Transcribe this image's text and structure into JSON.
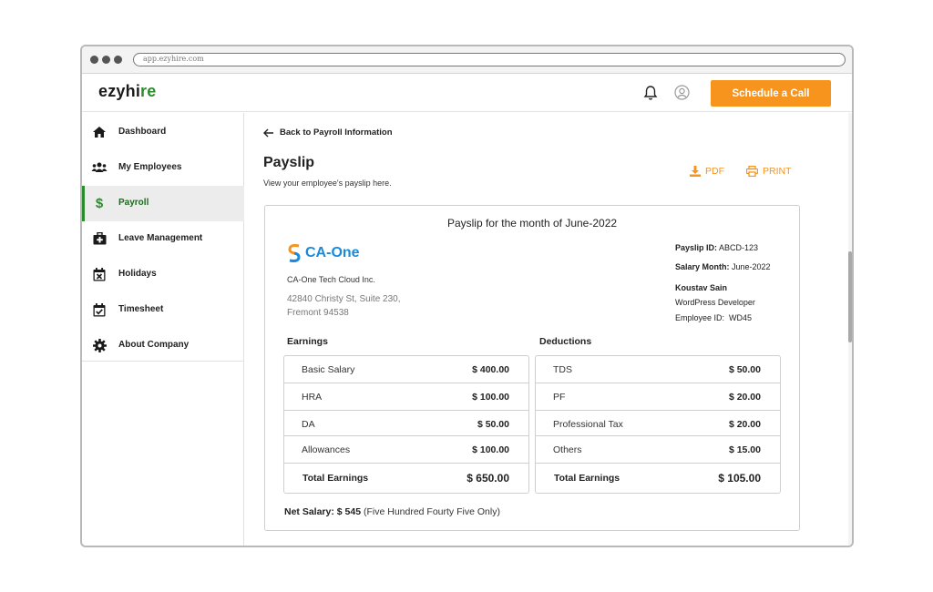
{
  "browser": {
    "url": "app.ezyhire.com"
  },
  "app": {
    "logo_main": "ezyhi",
    "logo_accent": "re",
    "schedule_label": "Schedule a Call"
  },
  "sidebar": {
    "items": [
      {
        "label": "Dashboard",
        "icon": "home-icon"
      },
      {
        "label": "My Employees",
        "icon": "users-icon"
      },
      {
        "label": "Payroll",
        "icon": "dollar-icon",
        "active": true
      },
      {
        "label": "Leave Management",
        "icon": "medical-kit-icon"
      },
      {
        "label": "Holidays",
        "icon": "calendar-x-icon"
      },
      {
        "label": "Timesheet",
        "icon": "calendar-check-icon"
      },
      {
        "label": "About Company",
        "icon": "gear-icon"
      }
    ]
  },
  "main": {
    "back_label": "Back to Payroll Information",
    "title": "Payslip",
    "subtitle": "View your employee's payslip here.",
    "pdf_label": "PDF",
    "print_label": "PRINT"
  },
  "payslip": {
    "heading": "Payslip for the month of June-2022",
    "company_logo_text": "CA-One",
    "company_name": "CA-One Tech Cloud Inc.",
    "address_line1": "42840 Christy St, Suite 230,",
    "address_line2": "Fremont 94538",
    "payslip_id_label": "Payslip ID:",
    "payslip_id": "ABCD-123",
    "salary_month_label": "Salary Month:",
    "salary_month": "June-2022",
    "employee_name": "Koustav Sain",
    "employee_role": "WordPress Developer",
    "employee_id_label": "Employee ID:",
    "employee_id": "WD45",
    "earnings_head": "Earnings",
    "deductions_head": "Deductions",
    "earnings": [
      {
        "label": "Basic Salary",
        "amount": "$ 400.00"
      },
      {
        "label": "HRA",
        "amount": "$ 100.00"
      },
      {
        "label": "DA",
        "amount": "$ 50.00"
      },
      {
        "label": "Allowances",
        "amount": "$ 100.00"
      }
    ],
    "earnings_total": {
      "label": "Total Earnings",
      "amount": "$ 650.00"
    },
    "deductions": [
      {
        "label": "TDS",
        "amount": "$ 50.00"
      },
      {
        "label": "PF",
        "amount": "$ 20.00"
      },
      {
        "label": "Professional Tax",
        "amount": "$ 20.00"
      },
      {
        "label": "Others",
        "amount": "$ 15.00"
      }
    ],
    "deductions_total": {
      "label": "Total Earnings",
      "amount": "$ 105.00"
    },
    "net_label": "Net Salary:",
    "net_amount": "$ 545",
    "net_words": "(Five Hundred Fourty Five Only)"
  },
  "colors": {
    "accent": "#f7941d",
    "brand_green": "#2e8b2e",
    "company_blue": "#1a8ad8"
  }
}
